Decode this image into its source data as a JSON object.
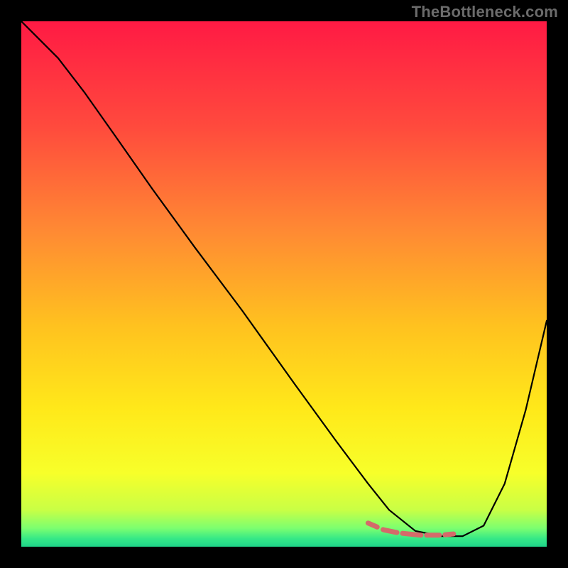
{
  "watermark": "TheBottleneck.com",
  "chart_data": {
    "type": "line",
    "title": "",
    "xlabel": "",
    "ylabel": "",
    "xlim": [
      0,
      100
    ],
    "ylim": [
      0,
      100
    ],
    "grid": false,
    "legend": false,
    "background_gradient": {
      "stops": [
        {
          "offset": 0.0,
          "color": "#ff1a44"
        },
        {
          "offset": 0.2,
          "color": "#ff4a3d"
        },
        {
          "offset": 0.4,
          "color": "#ff8a33"
        },
        {
          "offset": 0.58,
          "color": "#ffc21f"
        },
        {
          "offset": 0.74,
          "color": "#ffe91a"
        },
        {
          "offset": 0.86,
          "color": "#f7ff2a"
        },
        {
          "offset": 0.93,
          "color": "#c9ff45"
        },
        {
          "offset": 0.965,
          "color": "#7bff70"
        },
        {
          "offset": 0.985,
          "color": "#35e887"
        },
        {
          "offset": 1.0,
          "color": "#1fd488"
        }
      ]
    },
    "series": [
      {
        "name": "curve",
        "stroke": "#000000",
        "stroke_width": 2.2,
        "x": [
          0,
          3,
          7,
          12,
          18,
          25,
          33,
          42,
          52,
          60,
          66,
          70,
          75,
          80,
          84,
          88,
          92,
          96,
          100
        ],
        "y": [
          100,
          97,
          93,
          86.5,
          78,
          68,
          57,
          45,
          31,
          20,
          12,
          7,
          3,
          2,
          2,
          4,
          12,
          26,
          43
        ]
      },
      {
        "name": "highlight-band",
        "stroke": "#d46a6a",
        "stroke_width": 7,
        "linecap": "round",
        "x": [
          66,
          69,
          72,
          76,
          80,
          84,
          86.5
        ],
        "y": [
          4.5,
          3.2,
          2.6,
          2.2,
          2.2,
          2.6,
          3.5
        ]
      }
    ]
  }
}
